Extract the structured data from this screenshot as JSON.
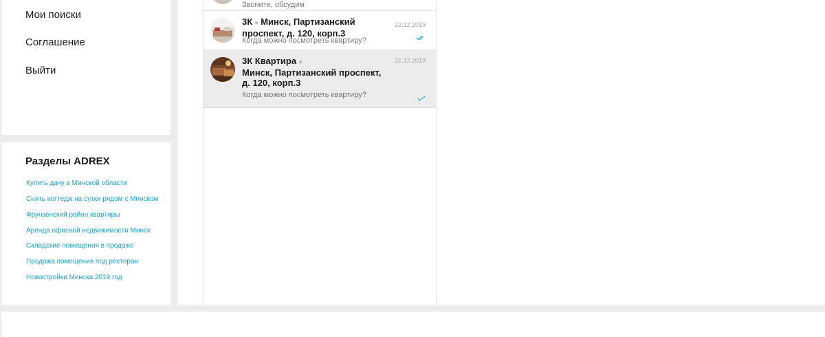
{
  "menu": {
    "items": [
      {
        "label": "Мои поиски"
      },
      {
        "label": "Соглашение"
      },
      {
        "label": "Выйти"
      }
    ]
  },
  "sections": {
    "title": "Разделы ADREX",
    "links": [
      "Купить дачу в Минской области",
      "Снять коттедж на сутки рядом с Минском",
      "Фрунзенский район квартиры",
      "Аренда офисной недвижимости Минск",
      "Складские помещения в продаже",
      "Продажа помещения под ресторан",
      "Новостройки Минска 2019 год"
    ]
  },
  "chats": {
    "partial_preview": "Звоните, обсудим",
    "items": [
      {
        "title_prefix": "3К",
        "title_rest": "Минск, Партизанский проспект, д. 120, корп.3",
        "date": "22.12.2019",
        "preview": "Когда можно посмотреть квартиру?",
        "status": "double-check"
      },
      {
        "title_prefix": "3К Квартира",
        "title_rest": "Минск, Партизанский проспект, д. 120, корп.3",
        "date": "22.12.2019",
        "preview": "Когда можно посмотреть квартиру?",
        "status": "single-check"
      }
    ]
  },
  "colors": {
    "link": "#1ba1c6",
    "check": "#2aa8d8",
    "active_row": "#ececec"
  }
}
